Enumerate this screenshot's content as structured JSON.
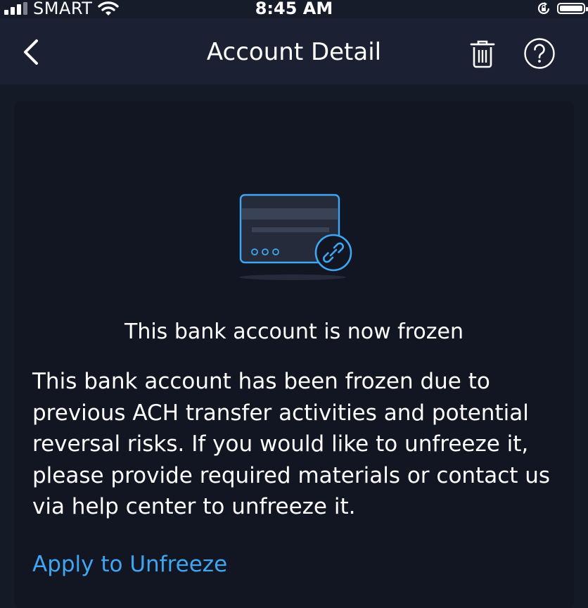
{
  "status_bar": {
    "carrier": "SMART",
    "time": "8:45 AM"
  },
  "nav": {
    "title": "Account Detail",
    "icons": [
      "back-chevron-icon",
      "trash-icon",
      "help-icon"
    ]
  },
  "frozen_notice": {
    "headline": "This bank account is now frozen",
    "body": "This bank account has been frozen due to previous ACH transfer activities and potential reversal risks. If you would like to unfreeze it, please provide required materials or contact us via help center to unfreeze it.",
    "action_label": "Apply to Unfreeze",
    "illustration": "frozen-card-unlink-icon"
  },
  "colors": {
    "background": "#151a27",
    "nav_background": "#1b2032",
    "card_background": "#121622",
    "accent": "#3ea6f2",
    "text": "#ffffff"
  }
}
